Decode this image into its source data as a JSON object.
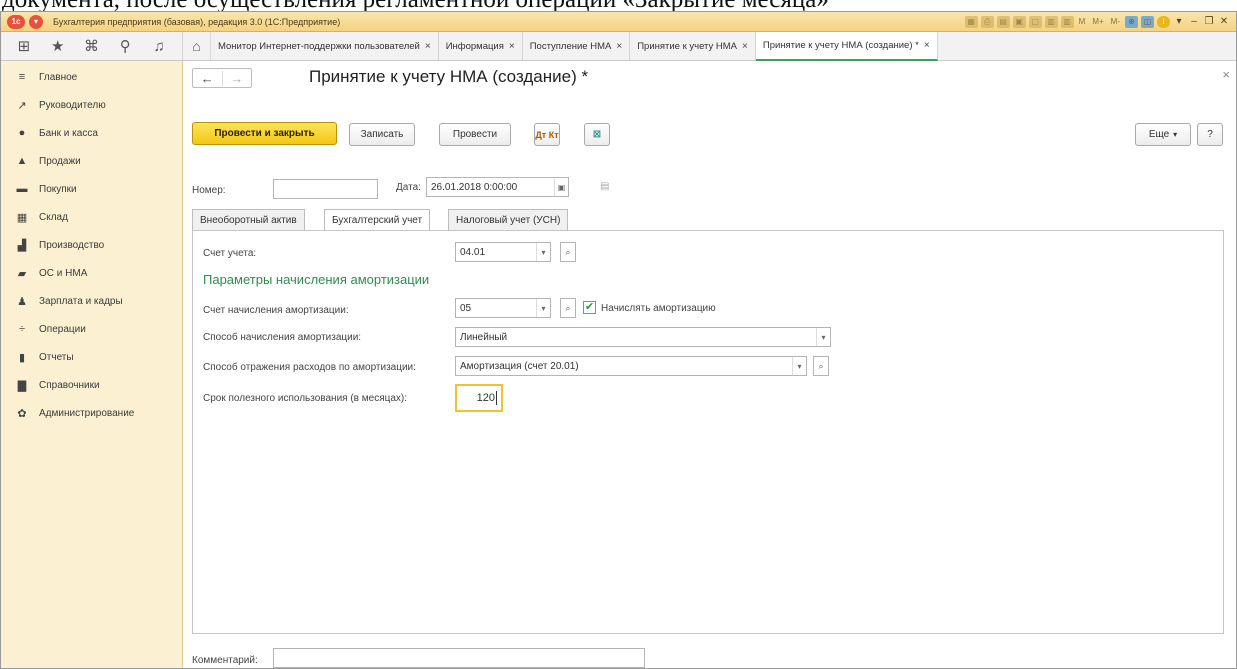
{
  "caption": "документа, после осуществления регламентной операции «Закрытие месяца»",
  "window": {
    "title": "Бухгалтерия предприятия (базовая), редакция 3.0 (1С:Предприятие)",
    "app_logo": "1с",
    "titlebar_text_icons": [
      "M",
      "M+",
      "M-"
    ]
  },
  "tabs": [
    {
      "label": "Монитор Интернет-поддержки пользователей"
    },
    {
      "label": "Информация"
    },
    {
      "label": "Поступление НМА"
    },
    {
      "label": "Принятие к учету НМА"
    },
    {
      "label": "Принятие к учету НМА (создание) *"
    }
  ],
  "tab_close": "×",
  "sidebar": {
    "items": [
      {
        "label": "Главное",
        "icon": "menu-lines-icon"
      },
      {
        "label": "Руководителю",
        "icon": "trend-icon"
      },
      {
        "label": "Банк и касса",
        "icon": "coin-icon"
      },
      {
        "label": "Продажи",
        "icon": "bag-icon"
      },
      {
        "label": "Покупки",
        "icon": "cart-icon"
      },
      {
        "label": "Склад",
        "icon": "warehouse-icon"
      },
      {
        "label": "Производство",
        "icon": "factory-icon"
      },
      {
        "label": "ОС и НМА",
        "icon": "truck-icon"
      },
      {
        "label": "Зарплата и кадры",
        "icon": "person-icon"
      },
      {
        "label": "Операции",
        "icon": "dt-kt-icon"
      },
      {
        "label": "Отчеты",
        "icon": "bar-chart-icon"
      },
      {
        "label": "Справочники",
        "icon": "book-icon"
      },
      {
        "label": "Администрирование",
        "icon": "gear-icon"
      }
    ]
  },
  "form": {
    "title": "Принятие к учету НМА (создание) *",
    "buttons": {
      "post_close": "Провести и закрыть",
      "save": "Записать",
      "post": "Провести",
      "dt_kt": "Дт Кт",
      "more": "Еще",
      "help": "?"
    },
    "number_label": "Номер:",
    "number_value": "",
    "date_label": "Дата:",
    "date_value": "26.01.2018  0:00:00",
    "form_tabs": [
      "Внеоборотный актив",
      "Бухгалтерский учет",
      "Налоговый учет (УСН)"
    ],
    "account_label": "Счет учета:",
    "account_value": "04.01",
    "section_title": "Параметры начисления амортизации",
    "amort_account_label": "Счет начисления амортизации:",
    "amort_account_value": "05",
    "accrue_checkbox_label": "Начислять амортизацию",
    "accrue_checked": true,
    "method_label": "Способ начисления амортизации:",
    "method_value": "Линейный",
    "expense_label": "Способ отражения расходов по амортизации:",
    "expense_value": "Амортизация (счет 20.01)",
    "useful_life_label": "Срок полезного использования (в месяцах):",
    "useful_life_value": "120",
    "comment_label": "Комментарий:",
    "comment_value": ""
  },
  "colors": {
    "sidebar_bg": "#fbf1d2",
    "primary_button": "#f2c813",
    "section_title": "#2f8c4f",
    "active_tab_underline": "#3aa05a"
  }
}
